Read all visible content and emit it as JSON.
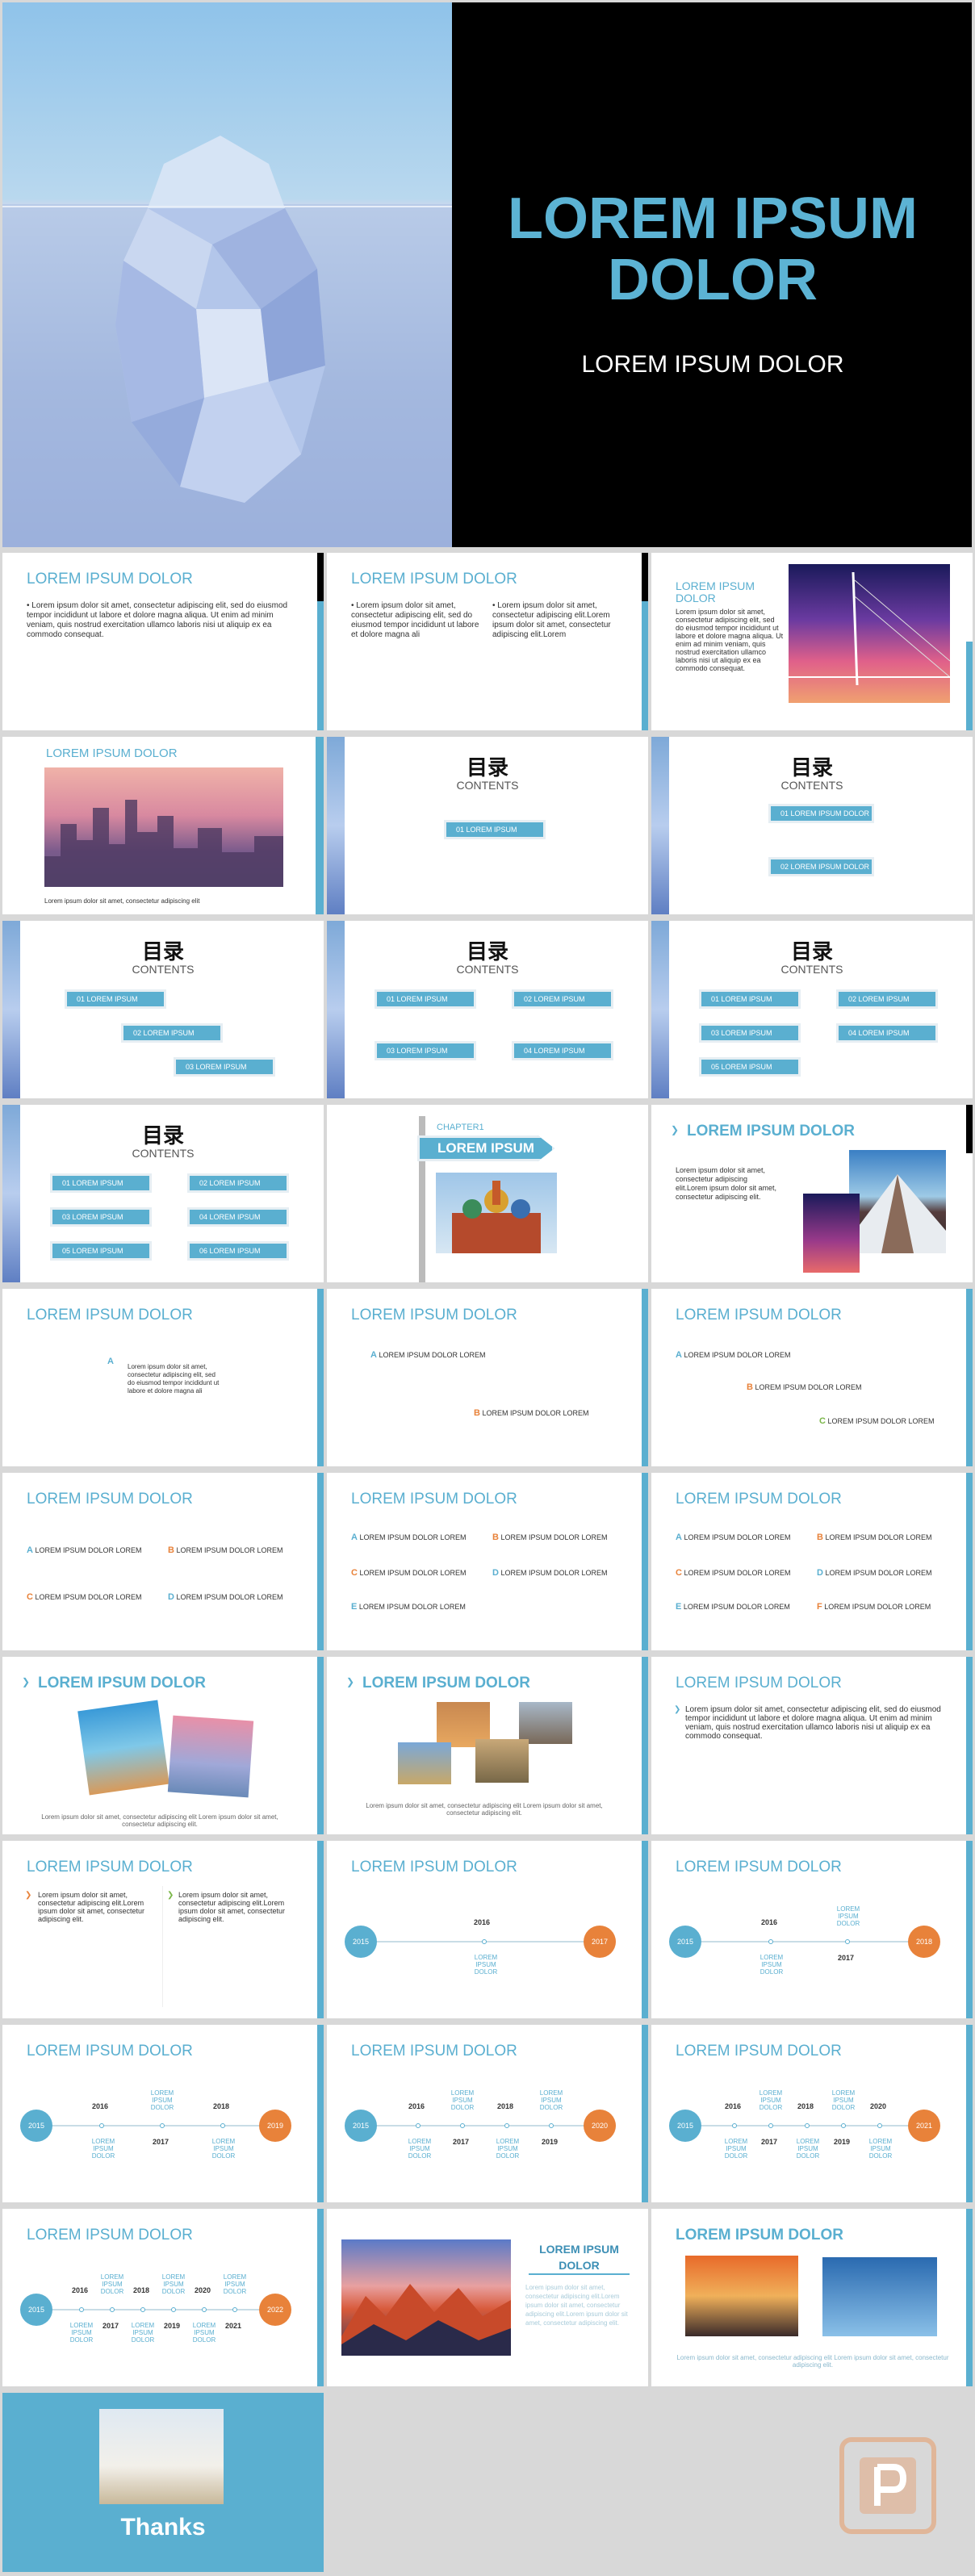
{
  "cover": {
    "title_line1": "LOREM IPSUM",
    "title_line2": "DOLOR",
    "subtitle": "LOREM IPSUM DOLOR"
  },
  "common": {
    "heading": "LOREM IPSUM DOLOR",
    "contents_cn": "目录",
    "contents_en": "CONTENTS"
  },
  "s2": {
    "bullet": "• Lorem ipsum dolor sit amet, consectetur adipiscing elit, sed do eiusmod tempor incididunt ut labore et dolore magna aliqua. Ut enim ad minim veniam, quis nostrud exercitation ullamco laboris nisi ut aliquip ex ea commodo consequat."
  },
  "s3": {
    "col1": "• Lorem ipsum dolor sit amet, consectetur adipiscing elit, sed do eiusmod tempor incididunt ut labore et dolore magna ali",
    "col2": "• Lorem ipsum dolor sit amet, consectetur adipiscing elit.Lorem ipsum dolor sit amet, consectetur adipiscing elit.Lorem"
  },
  "s4": {
    "title1": "LOREM IPSUM",
    "title2": "DOLOR",
    "text": "Lorem ipsum dolor sit amet, consectetur adipiscing elit, sed do eiusmod tempor incididunt ut labore et dolore magna aliqua. Ut enim ad minim veniam, quis nostrud exercitation ullamco laboris nisi ut aliquip ex ea commodo consequat."
  },
  "s5": {
    "caption": "Lorem ipsum dolor sit amet, consectetur adipiscing elit"
  },
  "toc": {
    "t1": "01 LOREM IPSUM DOLOR",
    "t2": "02 LOREM IPSUM DOLOR",
    "t3": "03 LOREM IPSUM DOLOR",
    "t4": "04 LOREM IPSUM DOLOR",
    "t5": "05 LOREM IPSUM DOLOR",
    "t6": "06 LOREM IPSUM DOLOR"
  },
  "chapter": {
    "label": "CHAPTER1",
    "title": "LOREM IPSUM"
  },
  "s12": {
    "text": "Lorem ipsum dolor sit amet, consectetur adipiscing elit.Lorem ipsum dolor sit amet, consectetur adipiscing elit."
  },
  "s13": {
    "text": "Lorem ipsum dolor sit amet, consectetur adipiscing elit, sed do eiusmod tempor incididunt ut labore et dolore magna ali"
  },
  "letters": {
    "a": "A",
    "b": "B",
    "c": "C",
    "d": "D",
    "e": "E",
    "f": "F",
    "item": "LOREM IPSUM DOLOR LOREM"
  },
  "s20": {
    "caption": "Lorem ipsum dolor sit amet, consectetur adipiscing elit Lorem ipsum dolor sit amet, consectetur adipiscing elit."
  },
  "s22": {
    "text": "Lorem ipsum dolor sit amet, consectetur adipiscing elit, sed do eiusmod tempor incididunt ut labore et dolore magna aliqua. Ut enim ad minim veniam, quis nostrud exercitation ullamco laboris nisi ut aliquip ex ea commodo consequat."
  },
  "s23": {
    "text": "Lorem ipsum dolor sit amet, consectetur adipiscing elit.Lorem ipsum dolor sit amet, consectetur adipiscing elit."
  },
  "timeline": {
    "y2015": "2015",
    "y2016": "2016",
    "y2017": "2017",
    "y2018": "2018",
    "y2019": "2019",
    "y2020": "2020",
    "y2021": "2021",
    "y2022": "2022",
    "label": "LOREM IPSUM DOLOR"
  },
  "s35": {
    "title1": "LOREM IPSUM",
    "title2": "DOLOR",
    "text": "Lorem ipsum dolor sit amet, consectetur adipiscing elit.Lorem ipsum dolor sit amet, consectetur adipiscing elit.Lorem ipsum dolor sit amet, consectetur adipiscing elit."
  },
  "s36": {
    "caption": "Lorem ipsum dolor sit amet, consectetur adipiscing elit Lorem ipsum dolor sit amet, consectetur adipiscing elit."
  },
  "end": {
    "thanks": "Thanks"
  },
  "colors": {
    "accent": "#5aafd0",
    "orange": "#e8823a",
    "green": "#7ab648"
  }
}
